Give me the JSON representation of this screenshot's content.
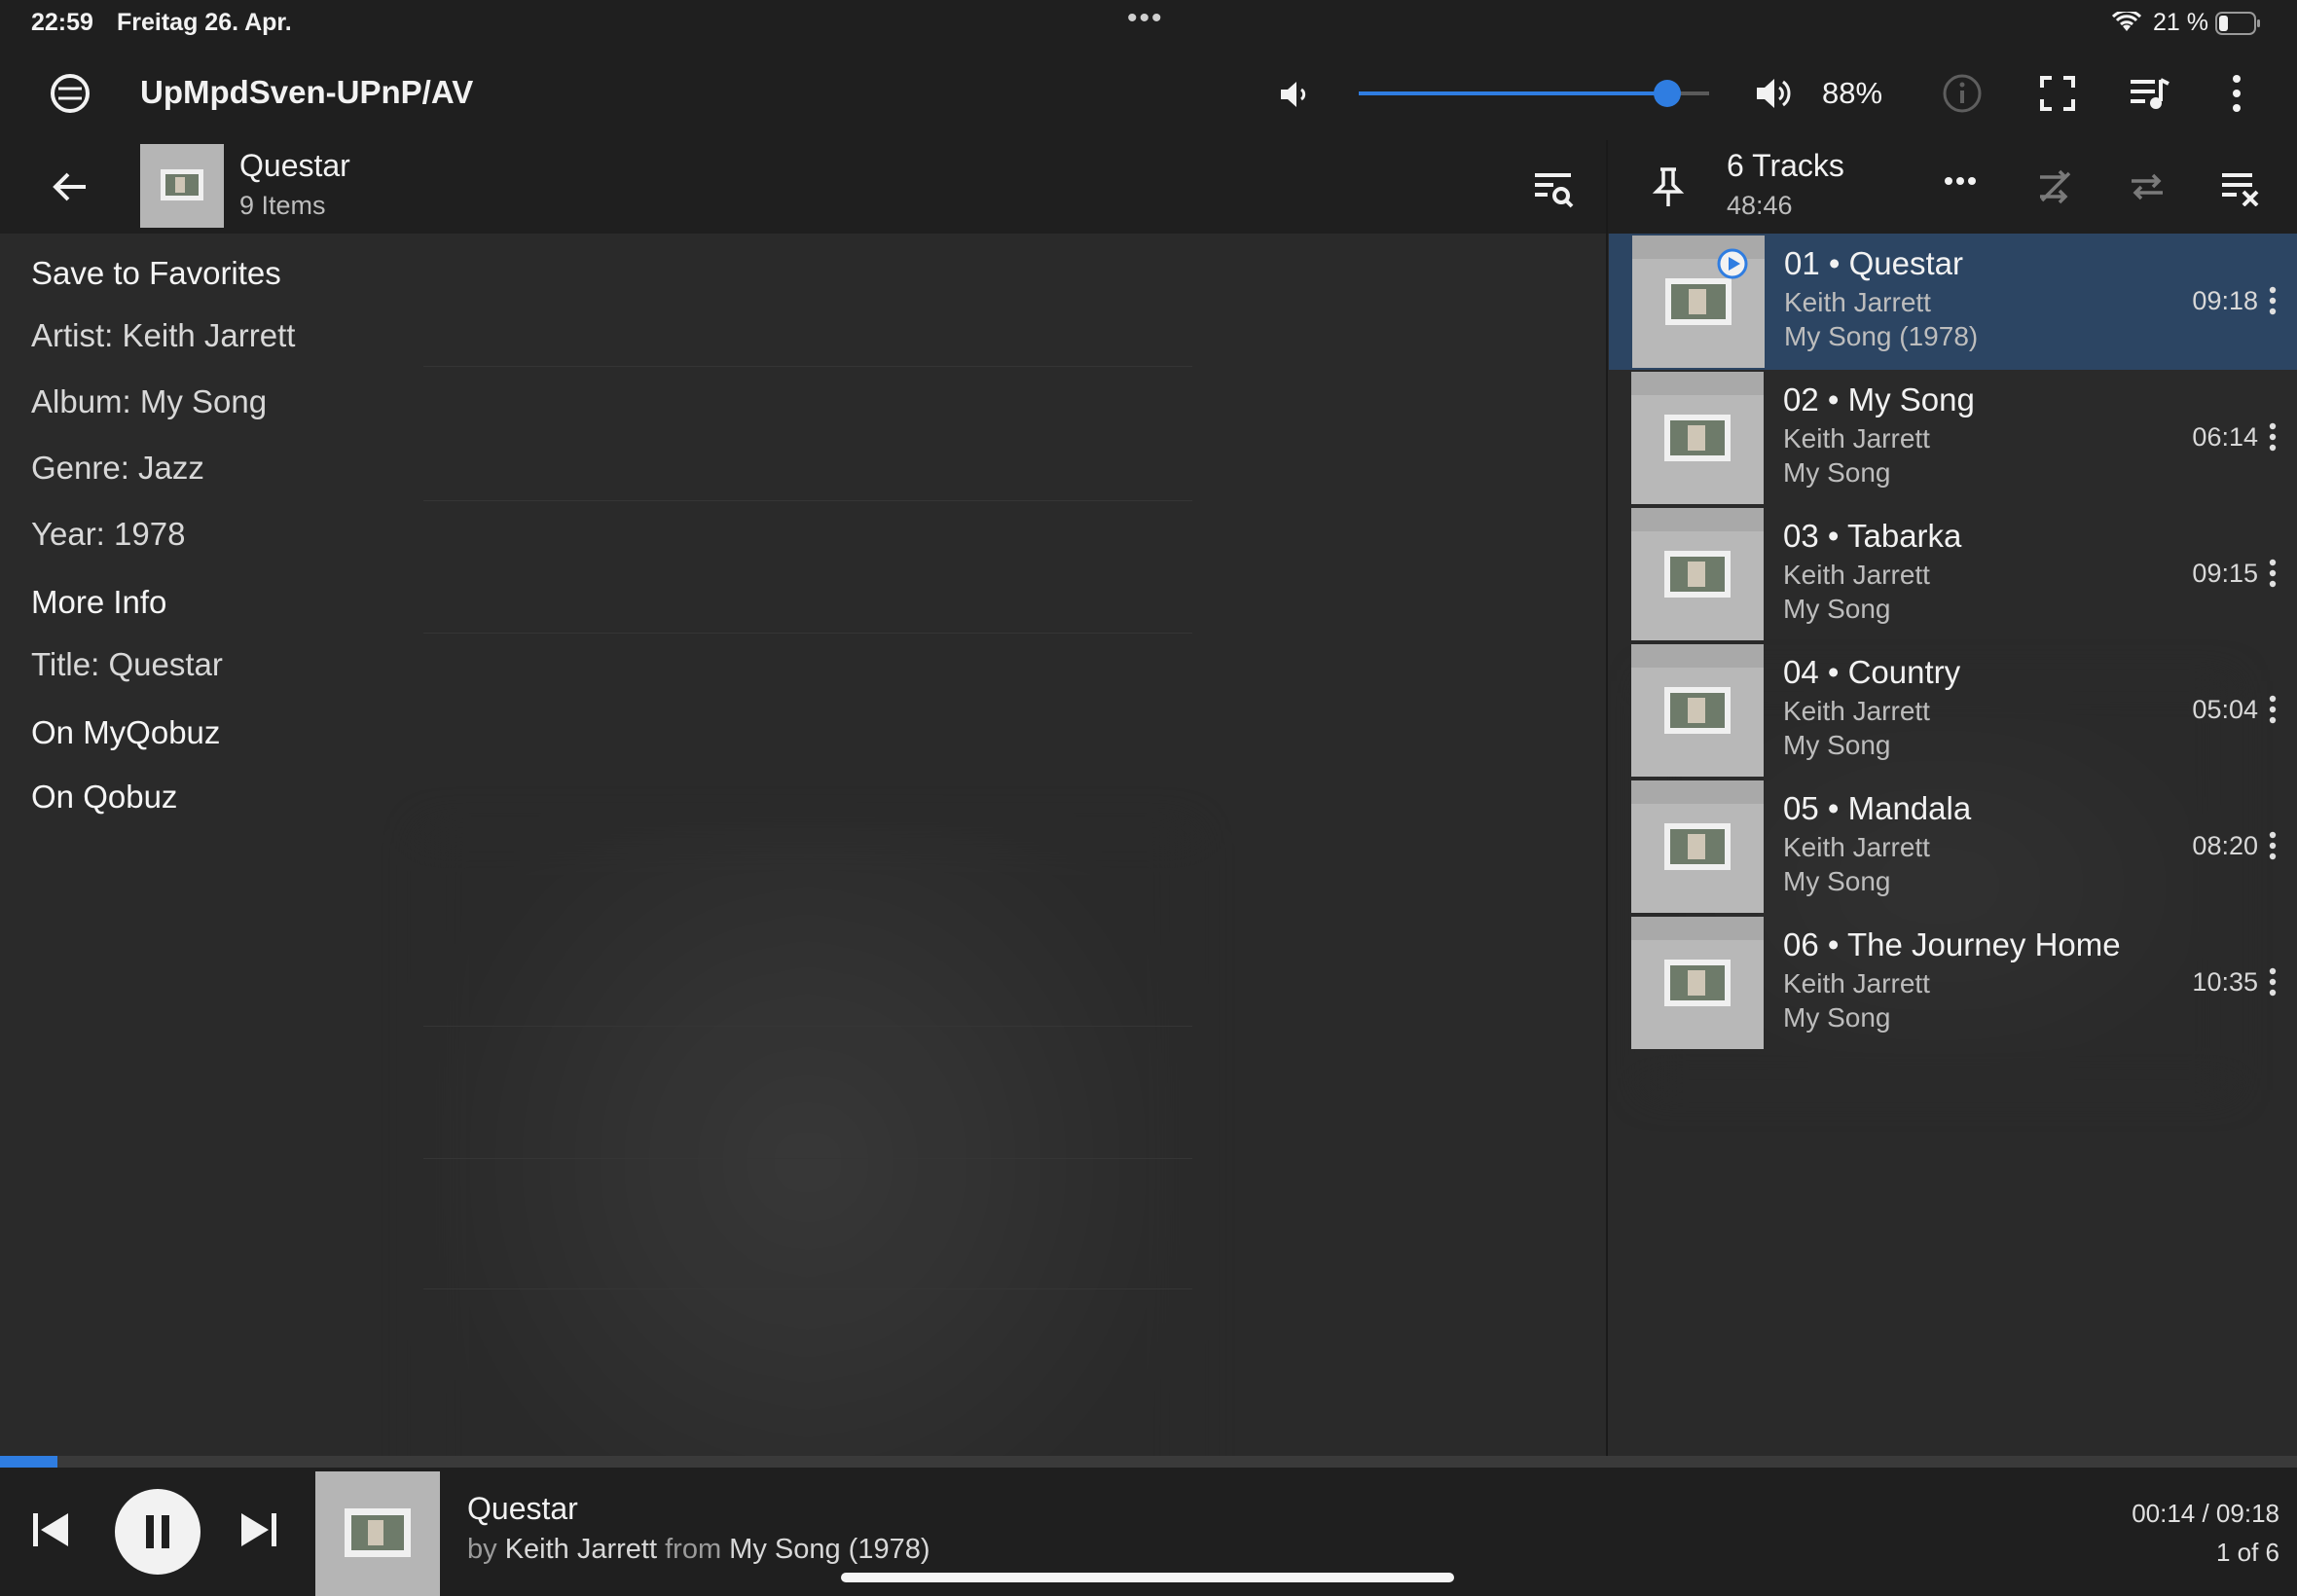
{
  "status_bar": {
    "time": "22:59",
    "date": "Freitag 26. Apr.",
    "battery": "21 %"
  },
  "header": {
    "renderer": "UpMpdSven-UPnP/AV",
    "volume_percent": "88%",
    "volume_level": 0.88
  },
  "browse": {
    "title": "Questar",
    "count": "9 Items",
    "rows": [
      {
        "label": "Save to Favorites",
        "bold": true
      },
      {
        "label": "Artist: Keith Jarrett",
        "bold": false
      },
      {
        "label": "Album: My Song",
        "bold": false
      },
      {
        "label": "Genre: Jazz",
        "bold": false
      },
      {
        "label": "Year: 1978",
        "bold": false
      },
      {
        "label": "More Info",
        "bold": true
      },
      {
        "label": "Title: Questar",
        "bold": false
      },
      {
        "label": "On MyQobuz",
        "bold": true
      },
      {
        "label": "On Qobuz",
        "bold": true
      }
    ]
  },
  "queue": {
    "count": "6 Tracks",
    "duration": "48:46",
    "tracks": [
      {
        "title": "01 • Questar",
        "artist": "Keith Jarrett",
        "album": "My Song (1978)",
        "duration": "09:18",
        "active": true
      },
      {
        "title": "02 • My Song",
        "artist": "Keith Jarrett",
        "album": "My Song",
        "duration": "06:14",
        "active": false
      },
      {
        "title": "03 • Tabarka",
        "artist": "Keith Jarrett",
        "album": "My Song",
        "duration": "09:15",
        "active": false
      },
      {
        "title": "04 • Country",
        "artist": "Keith Jarrett",
        "album": "My Song",
        "duration": "05:04",
        "active": false
      },
      {
        "title": "05 • Mandala",
        "artist": "Keith Jarrett",
        "album": "My Song",
        "duration": "08:20",
        "active": false
      },
      {
        "title": "06 • The Journey Home",
        "artist": "Keith Jarrett",
        "album": "My Song",
        "duration": "10:35",
        "active": false
      }
    ]
  },
  "player": {
    "title": "Questar",
    "by": "by",
    "artist": "Keith Jarrett",
    "from": "from",
    "album": "My Song (1978)",
    "time": "00:14 / 09:18",
    "position": "1 of 6",
    "progress": 0.025
  },
  "colors": {
    "accent": "#2f7de1",
    "active_row": "#2c4563",
    "bar_bg": "#1f1f1f",
    "content_bg": "#2a2a2a"
  }
}
